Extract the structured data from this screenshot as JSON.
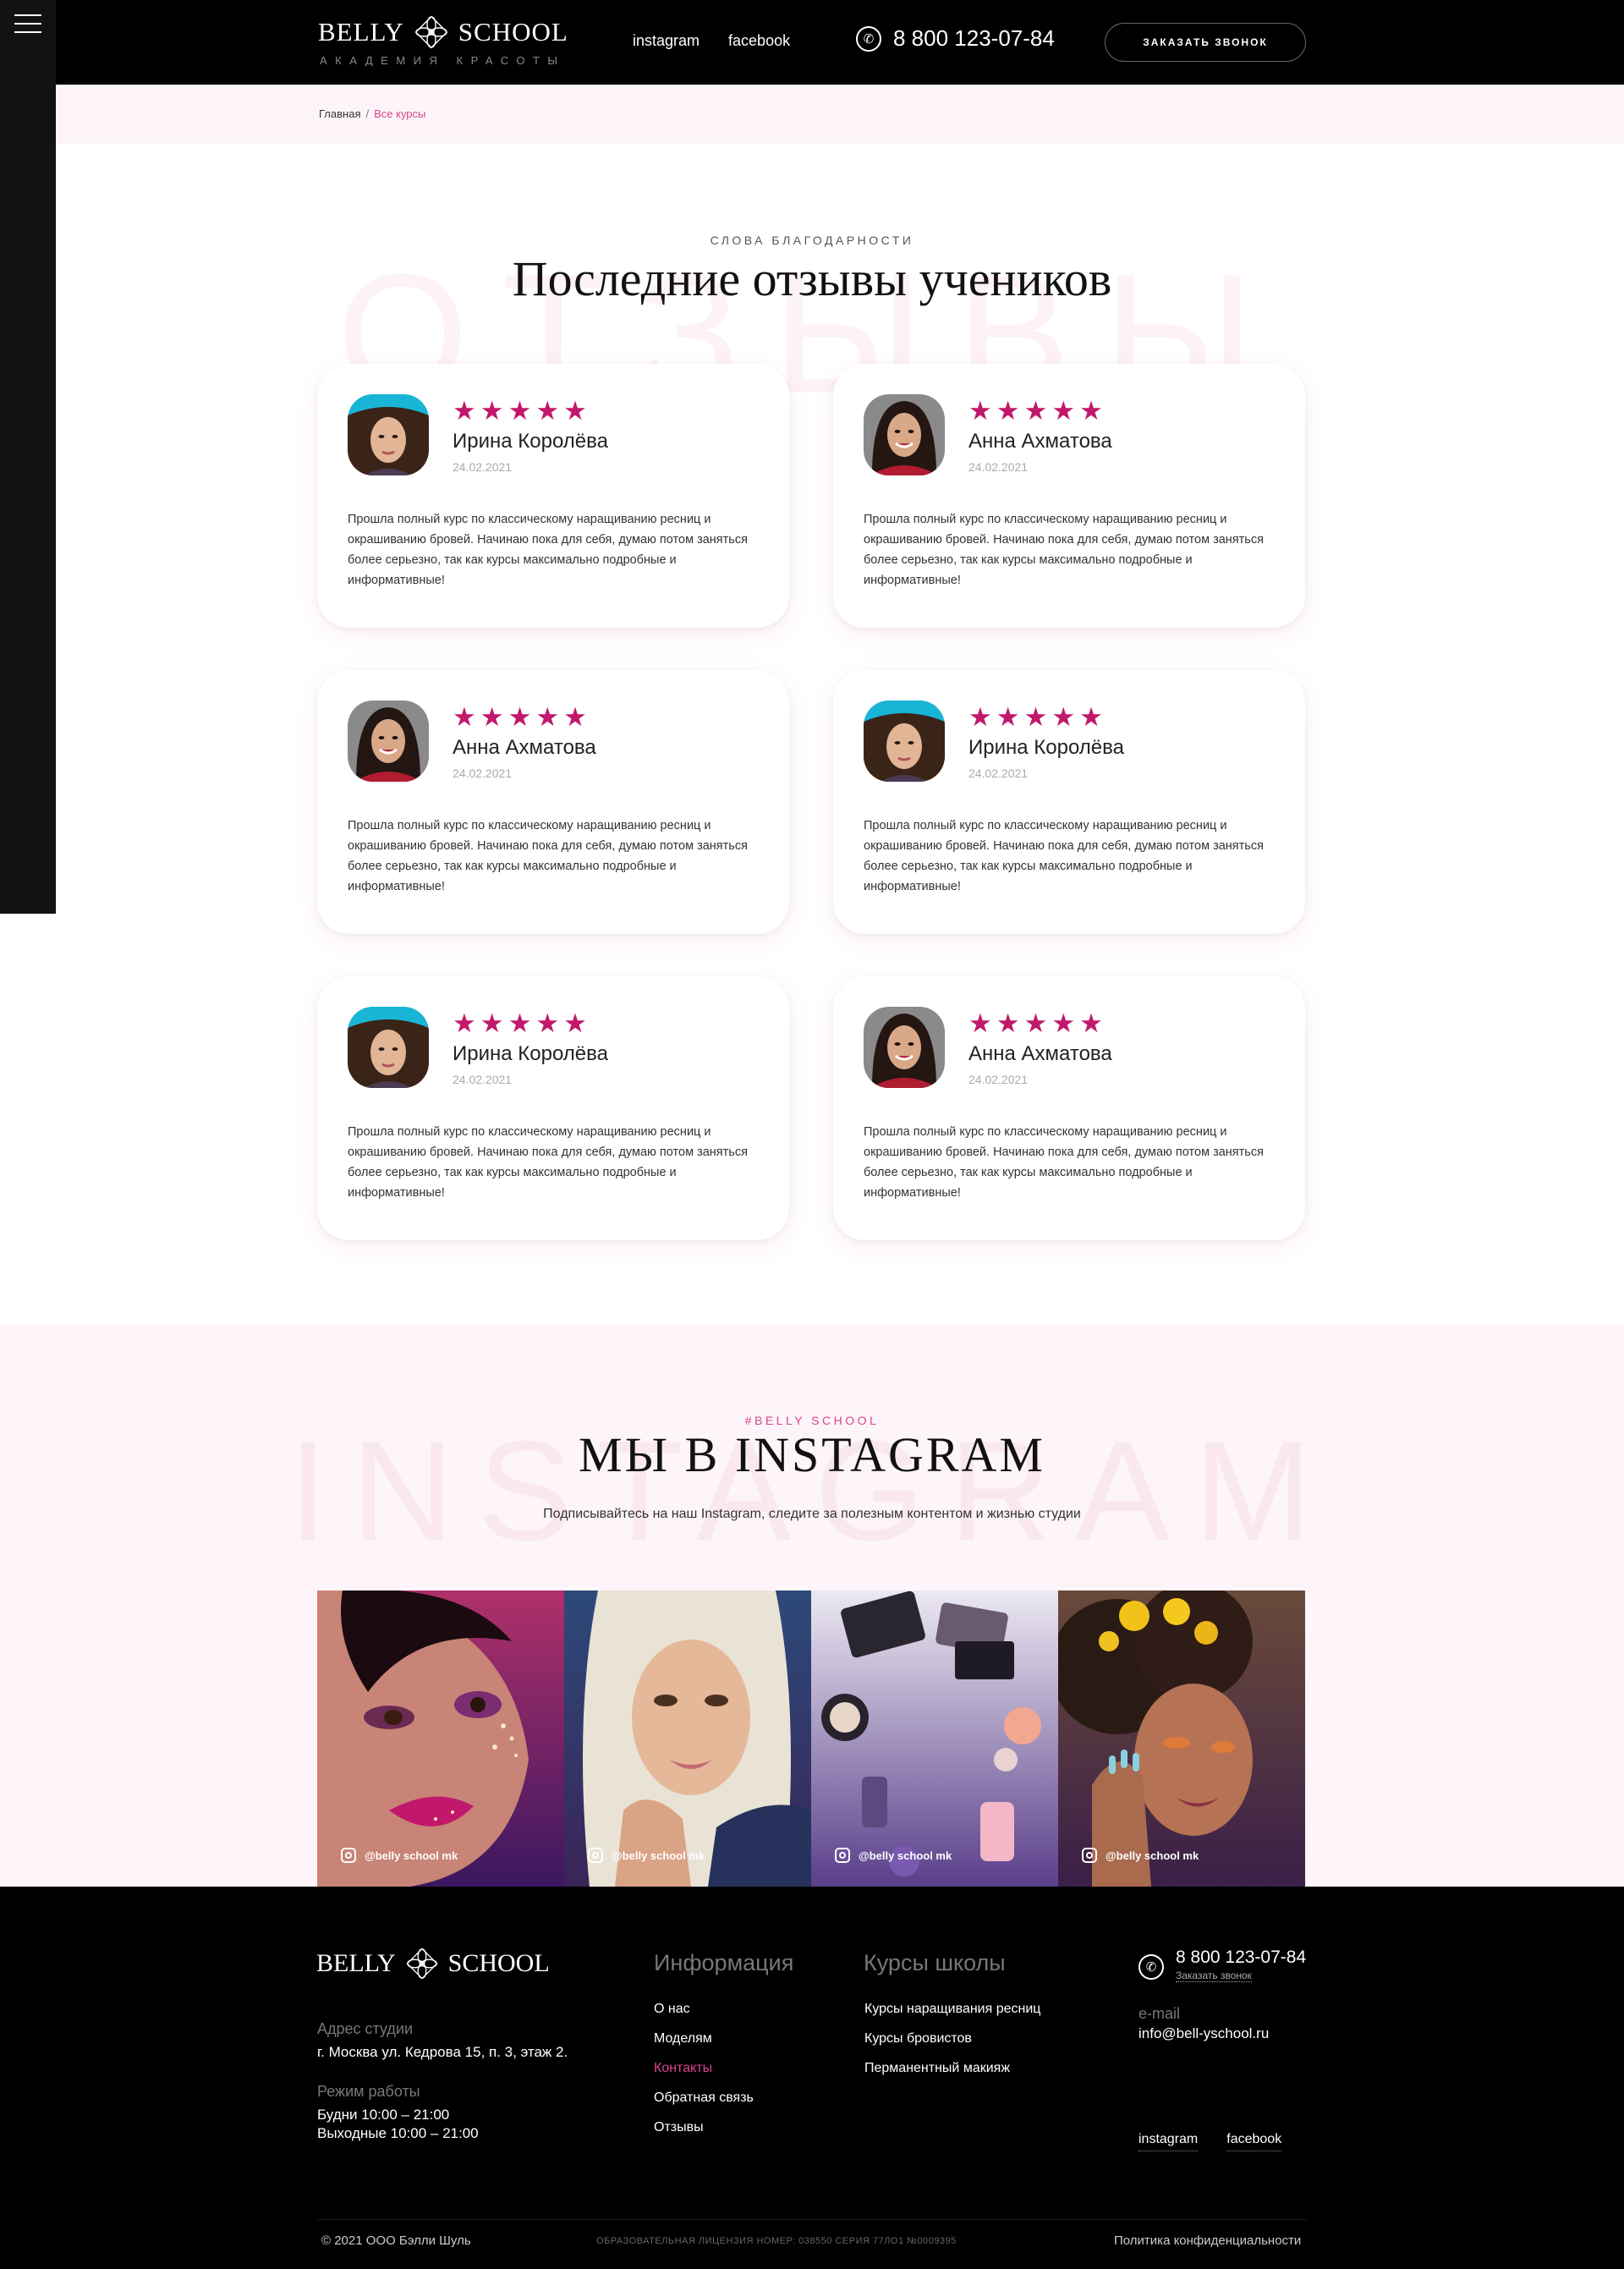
{
  "header": {
    "logo_left": "BELLY",
    "logo_right": "SCHOOL",
    "logo_sub": "АКАДЕМИЯ КРАСОТЫ",
    "nav": [
      "instagram",
      "facebook"
    ],
    "phone": "8 800 123-07-84",
    "callback_button": "ЗАКАЗАТЬ ЗВОНОК"
  },
  "breadcrumb": {
    "home": "Главная",
    "separator": "/",
    "current": "Все курсы"
  },
  "reviews": {
    "overline": "СЛОВА БЛАГОДАРНОСТИ",
    "title": "Последние отзывы учеников",
    "bg_word": "ОТЗЫВЫ",
    "stars": "★★★★★",
    "rating": 5,
    "items": [
      {
        "name": "Ирина Королёва",
        "date": "24.02.2021",
        "text": "Прошла полный курс по классическому наращиванию ресниц и окрашиванию бровей. Начинаю пока для себя, думаю потом заняться более серьезно, так как курсы максимально подробные и информативные!",
        "avatar": "portrait-teal-hat"
      },
      {
        "name": "Анна Ахматова",
        "date": "24.02.2021",
        "text": "Прошла полный курс по классическому наращиванию ресниц и окрашиванию бровей. Начинаю пока для себя, думаю потом заняться более серьезно, так как курсы максимально подробные и информативные!",
        "avatar": "portrait-red-top"
      },
      {
        "name": "Анна Ахматова",
        "date": "24.02.2021",
        "text": "Прошла полный курс по классическому наращиванию ресниц и окрашиванию бровей. Начинаю пока для себя, думаю потом заняться более серьезно, так как курсы максимально подробные и информативные!",
        "avatar": "portrait-red-top"
      },
      {
        "name": "Ирина Королёва",
        "date": "24.02.2021",
        "text": "Прошла полный курс по классическому наращиванию ресниц и окрашиванию бровей. Начинаю пока для себя, думаю потом заняться более серьезно, так как курсы максимально подробные и информативные!",
        "avatar": "portrait-teal-hat"
      },
      {
        "name": "Ирина Королёва",
        "date": "24.02.2021",
        "text": "Прошла полный курс по классическому наращиванию ресниц и окрашиванию бровей. Начинаю пока для себя, думаю потом заняться более серьезно, так как курсы максимально подробные и информативные!",
        "avatar": "portrait-teal-hat"
      },
      {
        "name": "Анна Ахматова",
        "date": "24.02.2021",
        "text": "Прошла полный курс по классическому наращиванию ресниц и окрашиванию бровей. Начинаю пока для себя, думаю потом заняться более серьезно, так как курсы максимально подробные и информативные!",
        "avatar": "portrait-red-top"
      }
    ]
  },
  "instagram": {
    "overline": "#BELLY SCHOOL",
    "title": "МЫ В INSTAGRAM",
    "bg_word": "INSTAGRAM",
    "subtitle": "Подписывайтесь на наш Instagram, следите за полезным контентом и жизнью студии",
    "photos": [
      {
        "handle": "@belly school mk",
        "theme": "purple-glitter-makeup"
      },
      {
        "handle": "@belly school mk",
        "theme": "blonde-model"
      },
      {
        "handle": "@belly school mk",
        "theme": "cosmetics-flatlay"
      },
      {
        "handle": "@belly school mk",
        "theme": "curly-hair-flowers"
      }
    ]
  },
  "footer": {
    "logo_left": "BELLY",
    "logo_right": "SCHOOL",
    "address_label": "Адрес студии",
    "address": "г. Москва ул. Кедрова 15, п. 3, этаж 2.",
    "hours_label": "Режим работы",
    "hours_weekdays": "Будни  10:00 – 21:00",
    "hours_weekend": "Выходные  10:00 – 21:00",
    "info_title": "Информация",
    "info_links": [
      "О нас",
      "Моделям",
      "Контакты",
      "Обратная связь",
      "Отзывы"
    ],
    "courses_title": "Курсы школы",
    "course_links": [
      "Курсы наращивания ресниц",
      "Курсы бровистов",
      "Перманентный макияж"
    ],
    "phone": "8 800 123-07-84",
    "phone_link": "Заказать звонок",
    "email_label": "e-mail",
    "email": "info@bell-yschool.ru",
    "social": [
      "instagram",
      "facebook"
    ],
    "copyright": "© 2021 ООО Бэлли Шуль",
    "license": "ОБРАЗОВАТЕЛЬНАЯ ЛИЦЕНЗИЯ НОМЕР: 038550 СЕРИЯ 77ЛО1 №0009395",
    "privacy": "Политика конфиденциальности"
  },
  "colors": {
    "accent": "#d6458d",
    "star": "#c2186b",
    "dark": "#000000",
    "light_pink_bg": "#fdf5f9"
  }
}
